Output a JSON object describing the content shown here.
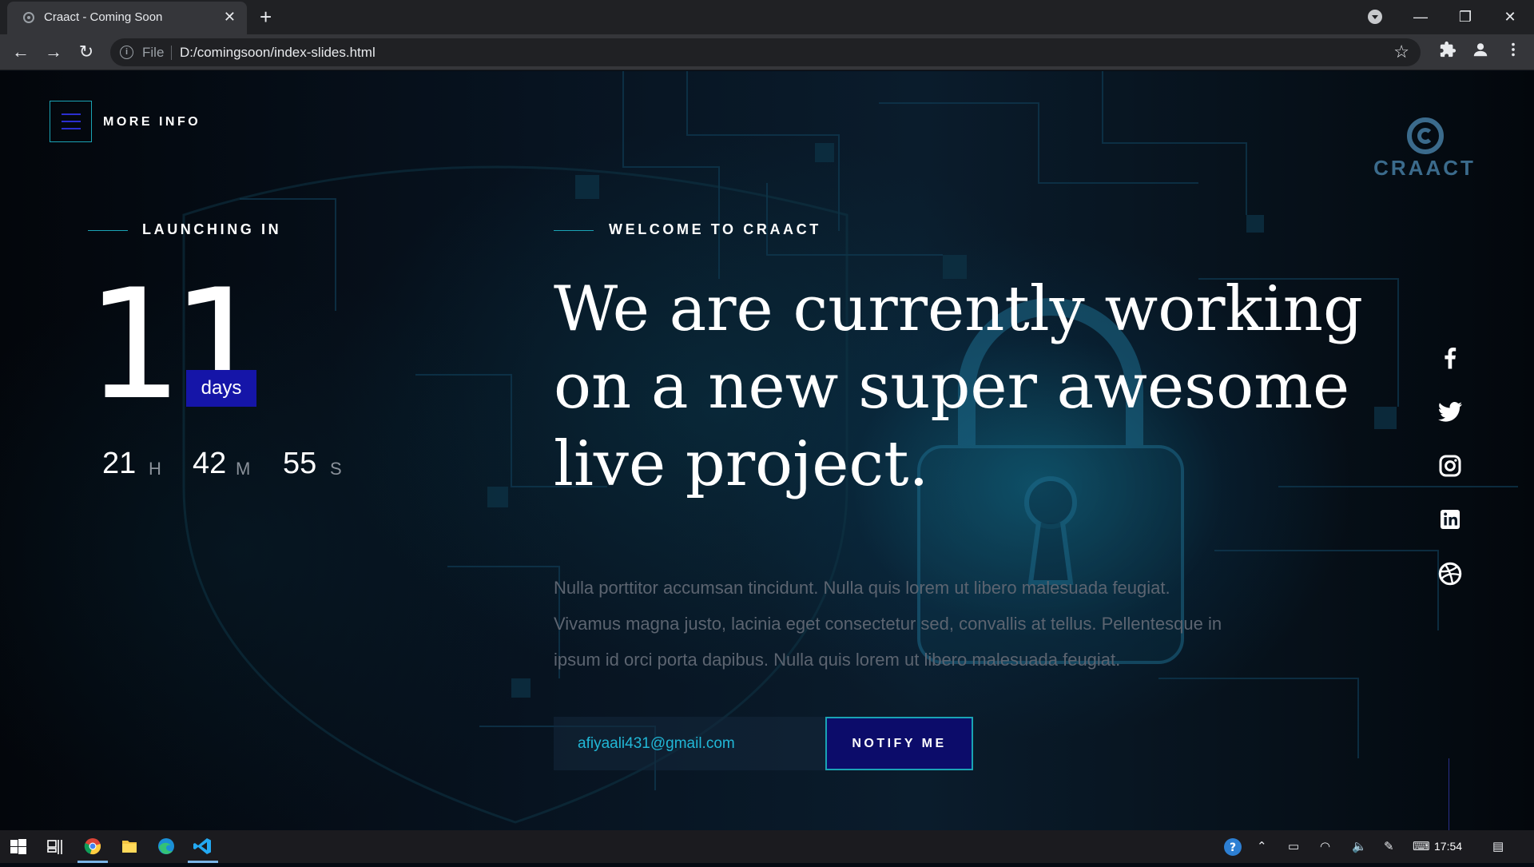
{
  "browser": {
    "tab_title": "Craact - Coming Soon",
    "url_scheme": "File",
    "url": "D:/comingsoon/index-slides.html"
  },
  "page": {
    "more_info": "MORE INFO",
    "logo_text": "CRAACT",
    "launching_label": "LAUNCHING IN",
    "countdown": {
      "days": "11",
      "days_unit": "days",
      "hours": "21",
      "hours_unit": "H",
      "minutes": "42",
      "minutes_unit": "M",
      "seconds": "55",
      "seconds_unit": "S"
    },
    "welcome_label": "WELCOME TO CRAACT",
    "headline_lines": [
      "We are currently working",
      "on a new super awesome",
      "live project."
    ],
    "lead_lines": [
      "Nulla porttitor accumsan tincidunt. Nulla quis lorem ut libero malesuada feugiat.",
      "Vivamus magna justo, lacinia eget consectetur sed, convallis at tellus. Pellentesque in",
      "ipsum id orci porta dapibus. Nulla quis lorem ut libero malesuada feugiat."
    ],
    "email_value": "afiyaali431@gmail.com",
    "notify_label": "NOTIFY ME",
    "social_icons": [
      "facebook-icon",
      "twitter-icon",
      "instagram-icon",
      "linkedin-icon",
      "dribbble-icon"
    ]
  },
  "taskbar": {
    "clock": "17:54"
  },
  "colors": {
    "accent_teal": "#1aa3b5",
    "accent_blue": "#1515a8",
    "logo": "#3b6b8c"
  }
}
